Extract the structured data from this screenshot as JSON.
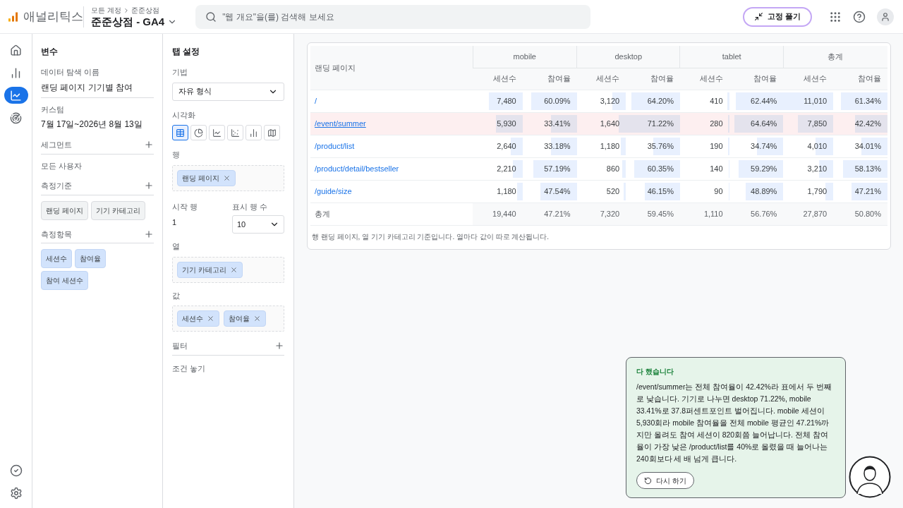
{
  "header": {
    "logo_text": "애널리틱스",
    "breadcrumb": [
      "모든 계정",
      "준준상점"
    ],
    "property": "준준상점 - GA4",
    "search_placeholder": "\"웹 개요\"을(를) 검색해 보세요",
    "unpin_button": "고정 풀기"
  },
  "nav": {
    "top_items": [
      {
        "selected": false
      },
      {
        "selected": false
      },
      {
        "selected": true
      },
      {
        "selected": false
      }
    ]
  },
  "variables": {
    "title": "변수",
    "name_label": "데이터 탐색 이름",
    "name_value": "랜딩 페이지 기기별 참여",
    "date_label": "커스텀",
    "date_value": "7월 17일~2026년 8월 13일",
    "segments_label": "세그먼트",
    "segment_items": [
      "모든 사용자"
    ],
    "dimensions_label": "측정기준",
    "dimension_chips": [
      "랜딩 페이지",
      "기기 카테고리"
    ],
    "metrics_label": "측정항목",
    "metric_chips": [
      "세션수",
      "참여율",
      "참여 세션수"
    ]
  },
  "tab_settings": {
    "title": "탭 설정",
    "technique_label": "기법",
    "technique_value": "자유 형식",
    "visualization_label": "시각화",
    "visualizations": [
      {
        "selected": true
      },
      {
        "selected": false
      },
      {
        "selected": false
      },
      {
        "selected": false
      },
      {
        "selected": false
      },
      {
        "selected": false
      }
    ],
    "rows_label": "행",
    "row_chips": [
      "랜딩 페이지"
    ],
    "start_row_label": "시작 행",
    "start_row": "1",
    "show_rows_label": "표시 행 수",
    "show_rows": "10",
    "columns_label": "열",
    "column_chips": [
      "기기 카테고리"
    ],
    "values_label": "값",
    "value_chips": [
      "세션수",
      "참여율"
    ],
    "filter_label": "필터",
    "filter_placeholder": "조건 놓기"
  },
  "table": {
    "row_header": "랜딩 페이지",
    "groups": [
      "mobile",
      "desktop",
      "tablet",
      "총계"
    ],
    "columns": [
      "세션수",
      "참여율",
      "세션수",
      "참여율",
      "세션수",
      "참여율",
      "세션수",
      "참여율"
    ],
    "rows": [
      {
        "page": "/",
        "selected": false,
        "cells": [
          {
            "value": "7,480",
            "level": 0.68
          },
          {
            "value": "60.09%",
            "level": 0.84
          },
          {
            "value": "3,120",
            "level": 0.28
          },
          {
            "value": "64.20%",
            "level": 0.9
          },
          {
            "value": "410",
            "level": 0.04
          },
          {
            "value": "62.44%",
            "level": 0.88
          },
          {
            "value": "11,010",
            "level": 1
          },
          {
            "value": "61.34%",
            "level": 0.86
          }
        ]
      },
      {
        "page": "/event/summer",
        "selected": true,
        "cells": [
          {
            "value": "5,930",
            "level": 0.54
          },
          {
            "value": "33.41%",
            "level": 0.47
          },
          {
            "value": "1,640",
            "level": 0.15
          },
          {
            "value": "71.22%",
            "level": 1
          },
          {
            "value": "280",
            "level": 0.03
          },
          {
            "value": "64.64%",
            "level": 0.91
          },
          {
            "value": "7,850",
            "level": 0.71
          },
          {
            "value": "42.42%",
            "level": 0.6
          }
        ]
      },
      {
        "page": "/product/list",
        "selected": false,
        "cells": [
          {
            "value": "2,640",
            "level": 0.24
          },
          {
            "value": "33.18%",
            "level": 0.47
          },
          {
            "value": "1,180",
            "level": 0.11
          },
          {
            "value": "35.76%",
            "level": 0.5
          },
          {
            "value": "190",
            "level": 0.02
          },
          {
            "value": "34.74%",
            "level": 0.49
          },
          {
            "value": "4,010",
            "level": 0.36
          },
          {
            "value": "34.01%",
            "level": 0.48
          }
        ]
      },
      {
        "page": "/product/detail/bestseller",
        "selected": false,
        "cells": [
          {
            "value": "2,210",
            "level": 0.2
          },
          {
            "value": "57.19%",
            "level": 0.8
          },
          {
            "value": "860",
            "level": 0.08
          },
          {
            "value": "60.35%",
            "level": 0.85
          },
          {
            "value": "140",
            "level": 0.01
          },
          {
            "value": "59.29%",
            "level": 0.83
          },
          {
            "value": "3,210",
            "level": 0.29
          },
          {
            "value": "58.13%",
            "level": 0.82
          }
        ]
      },
      {
        "page": "/guide/size",
        "selected": false,
        "cells": [
          {
            "value": "1,180",
            "level": 0.11
          },
          {
            "value": "47.54%",
            "level": 0.67
          },
          {
            "value": "520",
            "level": 0.05
          },
          {
            "value": "46.15%",
            "level": 0.65
          },
          {
            "value": "90",
            "level": 0.01
          },
          {
            "value": "48.89%",
            "level": 0.69
          },
          {
            "value": "1,790",
            "level": 0.16
          },
          {
            "value": "47.21%",
            "level": 0.66
          }
        ]
      }
    ],
    "total_row": {
      "label": "총계",
      "cells": [
        "19,440",
        "47.21%",
        "7,320",
        "59.45%",
        "1,110",
        "56.76%",
        "27,870",
        "50.80%"
      ]
    },
    "footnote": "행 랜딩 페이지, 열 기기 카테고리 기준입니다. 열마다 값이 따로 계산됩니다."
  },
  "assistant": {
    "status": "다 했습니다",
    "message": "/event/summer는 전체 참여율이 42.42%라 표에서 두 번째로 낮습니다. 기기로 나누면 desktop 71.22%, mobile 33.41%로 37.8퍼센트포인트 벌어집니다. mobile 세션이 5,930회라 mobile 참여율을 전체 mobile 평균인 47.21%까지만 올려도 참여 세션이 820회쯤 늘어납니다. 전체 참여율이 가장 낮은 /product/list를 40%로 올렸을 때 늘어나는 240회보다 세 배 넘게 큽니다.",
    "retry_button": "다시 하기"
  }
}
